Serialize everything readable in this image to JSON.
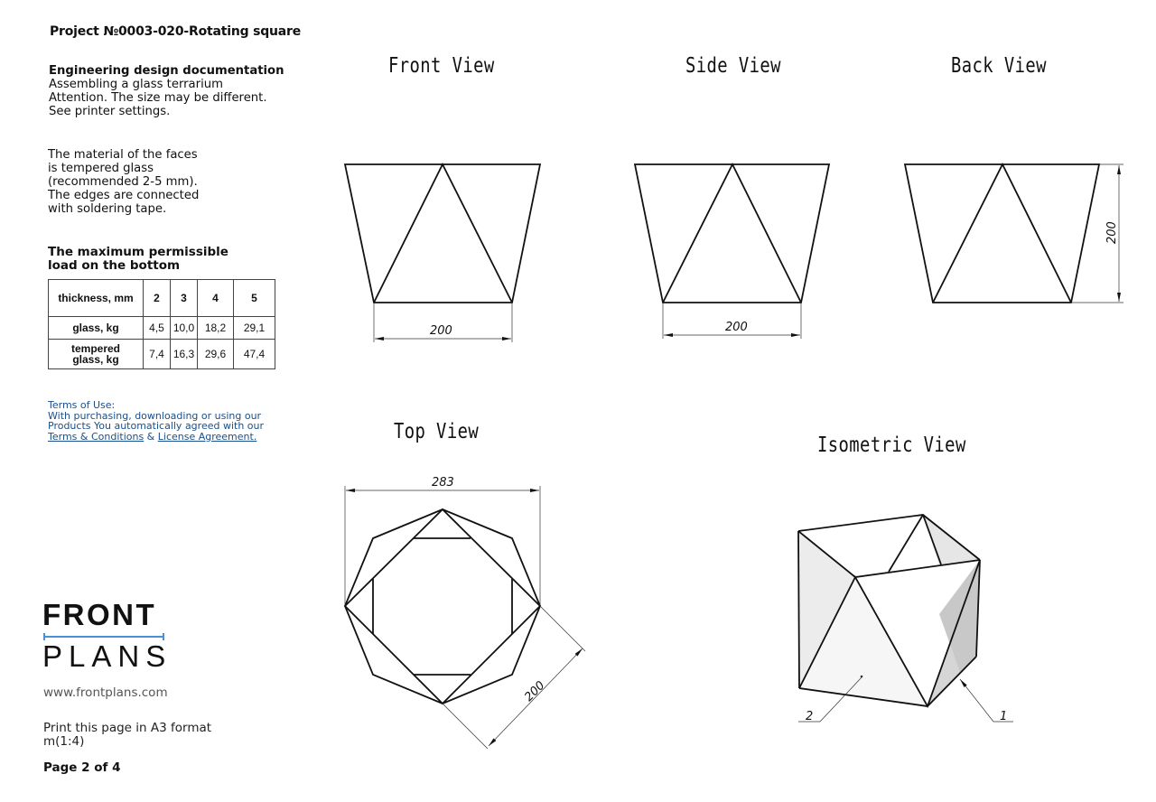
{
  "header": {
    "project_title": "Project №0003-020-Rotating square"
  },
  "description": {
    "heading": "Engineering design documentation",
    "lines": [
      "Assembling a glass terrarium",
      "Attention. The size may be different.",
      "See printer settings."
    ]
  },
  "material": {
    "lines": [
      "The material of the faces",
      "is tempered glass",
      "(recommended 2-5 mm).",
      "The edges are connected",
      "with soldering tape."
    ]
  },
  "load_table": {
    "heading_lines": [
      "The maximum permissible",
      "load on the bottom"
    ],
    "header": {
      "label": "thickness, mm",
      "values": [
        "2",
        "3",
        "4",
        "5"
      ]
    },
    "rows": [
      {
        "label_lines": [
          "glass, kg"
        ],
        "values": [
          "4,5",
          "10,0",
          "18,2",
          "29,1"
        ]
      },
      {
        "label_lines": [
          "tempered",
          "glass, kg"
        ],
        "values": [
          "7,4",
          "16,3",
          "29,6",
          "47,4"
        ]
      }
    ]
  },
  "terms": {
    "heading": "Terms of Use:",
    "lines": [
      "With purchasing, downloading or using our",
      "Products You automatically agreed with our"
    ],
    "link_terms": "Terms & Conditions",
    "separator": " & ",
    "link_license": "License Agreement."
  },
  "branding": {
    "logo_top": "FRONT",
    "logo_bottom": "PLANS",
    "accent_color": "#4a90d9",
    "website": "www.frontplans.com"
  },
  "print_info": {
    "lines": [
      "Print this page in A3 format",
      "m(1:4)"
    ],
    "page_label": "Page 2 of 4"
  },
  "views": {
    "front": {
      "title": "Front View",
      "dimension": "200"
    },
    "side": {
      "title": "Side View",
      "dimension": "200"
    },
    "back": {
      "title": "Back View",
      "dimension": "200"
    },
    "top": {
      "title": "Top View",
      "dimension_width": "283",
      "dimension_side": "200"
    },
    "isometric": {
      "title": "Isometric View",
      "callout_1": "1",
      "callout_2": "2"
    }
  }
}
